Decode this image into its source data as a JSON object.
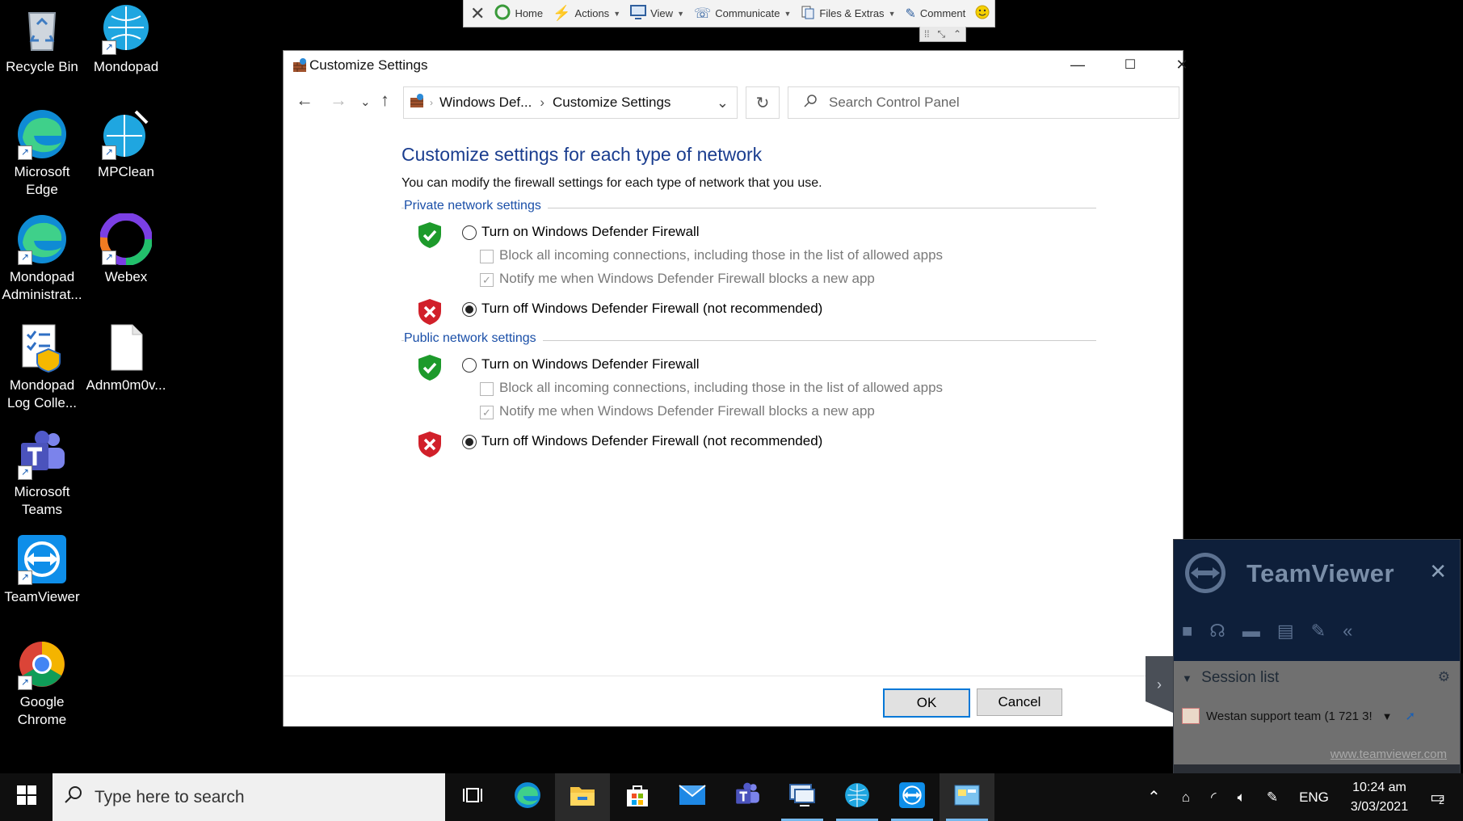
{
  "desktop_icons": [
    {
      "label": "Recycle Bin"
    },
    {
      "label": "Mondopad"
    },
    {
      "label": "Microsoft Edge"
    },
    {
      "label": "MPClean"
    },
    {
      "label": "Mondopad Administrat..."
    },
    {
      "label": "Webex"
    },
    {
      "label": "Mondopad Log Colle..."
    },
    {
      "label": "Adnm0m0v..."
    },
    {
      "label": "Microsoft Teams"
    },
    {
      "label": "TeamViewer"
    },
    {
      "label": "Google Chrome"
    }
  ],
  "tv_toolbar": {
    "home": "Home",
    "actions": "Actions",
    "view": "View",
    "communicate": "Communicate",
    "files": "Files & Extras",
    "comment": "Comment"
  },
  "window": {
    "title": "Customize Settings",
    "breadcrumb_1": "Windows Def...",
    "breadcrumb_sep": "›",
    "breadcrumb_2": "Customize Settings",
    "search_placeholder": "Search Control Panel",
    "heading": "Customize settings for each type of network",
    "intro": "You can modify the firewall settings for each type of network that you use.",
    "private": {
      "title": "Private network settings",
      "turn_on": "Turn on Windows Defender Firewall",
      "block_all": "Block all incoming connections, including those in the list of allowed apps",
      "notify": "Notify me when Windows Defender Firewall blocks a new app",
      "turn_off": "Turn off Windows Defender Firewall (not recommended)",
      "selected": "off"
    },
    "public": {
      "title": "Public network settings",
      "turn_on": "Turn on Windows Defender Firewall",
      "block_all": "Block all incoming connections, including those in the list of allowed apps",
      "notify": "Notify me when Windows Defender Firewall blocks a new app",
      "turn_off": "Turn off Windows Defender Firewall (not recommended)",
      "selected": "off"
    },
    "ok": "OK",
    "cancel": "Cancel"
  },
  "teamviewer_panel": {
    "brand": "TeamViewer",
    "session_list": "Session list",
    "session_item": "Westan support team (1 721 3!",
    "link": "www.teamviewer.com"
  },
  "taskbar": {
    "search_placeholder": "Type here to search",
    "language": "ENG",
    "time": "10:24 am",
    "date": "3/03/2021",
    "notifications": "2"
  },
  "colors": {
    "heading_blue": "#1a3d8f",
    "link_blue": "#1a4fa8",
    "shield_green": "#1d9a2b",
    "shield_red": "#d1202a",
    "accent": "#0078d7"
  }
}
